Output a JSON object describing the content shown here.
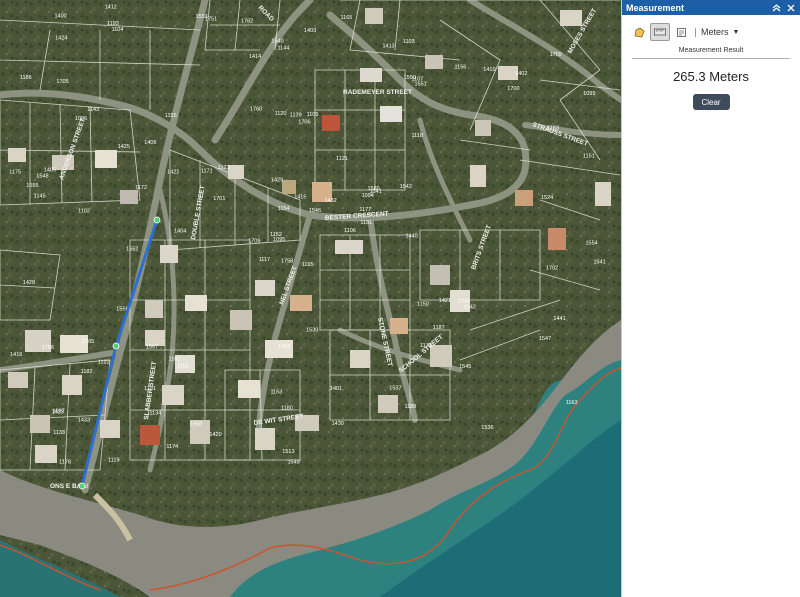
{
  "panel": {
    "title": "Measurement",
    "unit": "Meters",
    "result_label": "Measurement Result",
    "result_value": "265.3 Meters",
    "clear_label": "Clear"
  },
  "map": {
    "street_labels": [
      "BESTER CRESCENT",
      "RADEMEYER STREET",
      "STRAUSS STREET",
      "DE WIT STREET",
      "STONE STREET",
      "BRITS STREET",
      "SLABBER STREET",
      "NEL STREET",
      "MOSES STREET",
      "DOUBLE STREET",
      "ANDERSON STREET",
      "SCHOOL STREET",
      "ROAD",
      "ONS E BAAI"
    ],
    "parcel_numbers": [
      "1195",
      "1096",
      "1095",
      "1097",
      "1094",
      "1101",
      "1103",
      "1105",
      "1107",
      "1106",
      "1104",
      "1102",
      "1099",
      "1117",
      "1118",
      "1119",
      "1120",
      "1121",
      "1122",
      "1123",
      "1133",
      "1134",
      "1139",
      "1141",
      "1142",
      "1143",
      "1144",
      "1145",
      "1150",
      "1151",
      "1152",
      "1153",
      "1154",
      "1155",
      "1156",
      "1161",
      "1163",
      "1164",
      "1165",
      "1171",
      "1172",
      "1173",
      "1174",
      "1175",
      "1177",
      "1178",
      "1180",
      "1181",
      "1182",
      "1183",
      "1186",
      "1187",
      "1188",
      "1191",
      "1193",
      "1400",
      "1401",
      "1402",
      "1403",
      "1404",
      "1405",
      "1406",
      "1410",
      "1412",
      "1413",
      "1414",
      "1415",
      "1416",
      "1418",
      "1420",
      "1421",
      "1422",
      "1423",
      "1424",
      "1425",
      "1428",
      "1429",
      "1430",
      "1432",
      "1433",
      "1440",
      "1441",
      "1513",
      "1524",
      "1530",
      "1536",
      "1537",
      "1540",
      "1541",
      "1542",
      "1545",
      "1546",
      "1547",
      "1548",
      "1549",
      "1550",
      "1551",
      "1552",
      "1553",
      "1554",
      "1555",
      "1556",
      "1557",
      "1558",
      "1560",
      "1700",
      "1701",
      "1702",
      "1705",
      "1706",
      "1709",
      "1751",
      "1756",
      "1758",
      "1759",
      "1760",
      "1762",
      "1765"
    ],
    "colors": {
      "measure_line": "#2d6fd0",
      "measure_vertex": "#4fd27a",
      "coastline": "#d4502a",
      "panel_header": "#1d5fa6"
    }
  }
}
